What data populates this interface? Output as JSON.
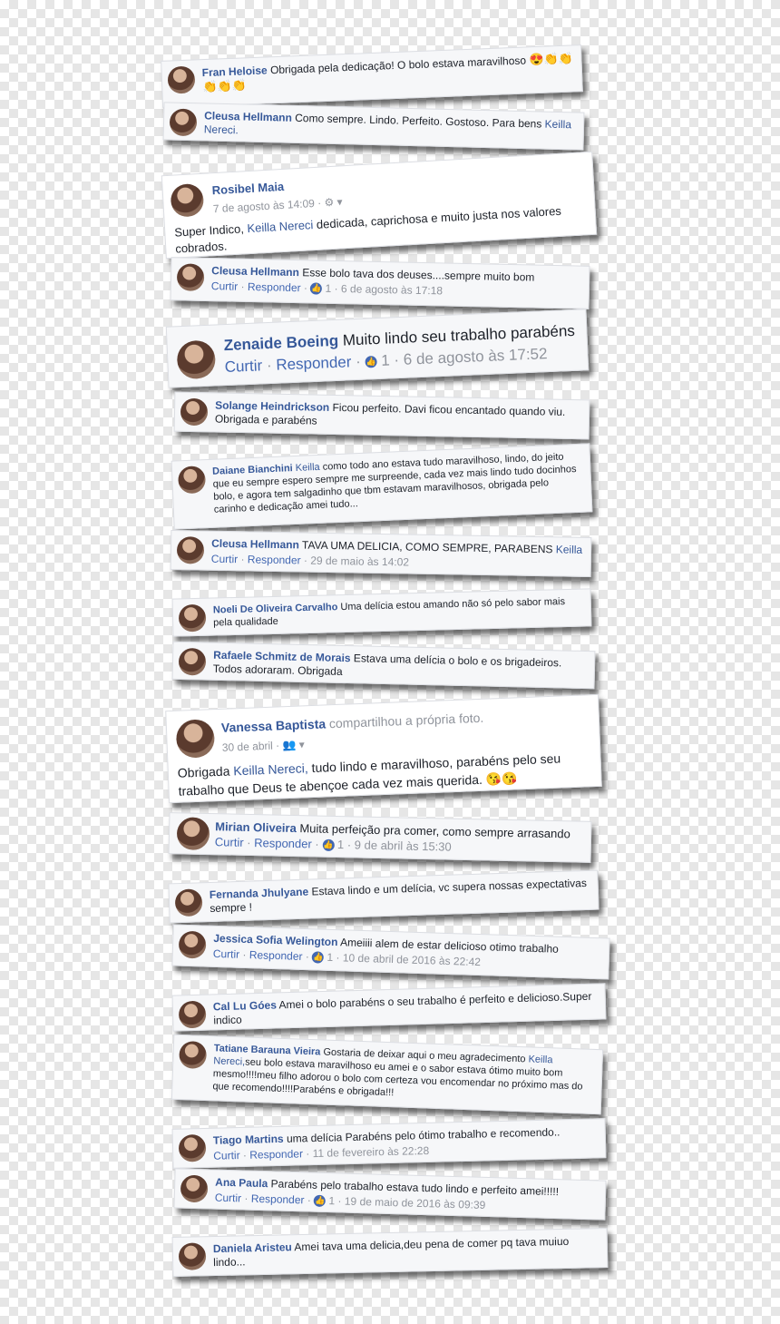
{
  "comments": [
    {
      "name": "Fran Heloise",
      "text": "Obrigada pela dedicação! O bolo estava maravilhoso",
      "emoji": "😍👏👏👏👏👏"
    },
    {
      "name": "Cleusa Hellmann",
      "text": "Como sempre. Lindo. Perfeito. Gostoso. Para bens",
      "tag": "Keilla Nereci."
    },
    {
      "name": "Rosibel Maia",
      "date": "7 de agosto às 14:09 · ⚙ ▾",
      "text_pre": "Super Indico,",
      "tag": "Keilla Nereci",
      "text_post": "dedicada, caprichosa e muito justa nos valores cobrados."
    },
    {
      "name": "Cleusa Hellmann",
      "text": "Esse bolo tava dos deuses....sempre muito bom",
      "curtir": "Curtir",
      "responder": "Responder",
      "likes": "1",
      "date": "6 de agosto às 17:18"
    },
    {
      "name": "Zenaide Boeing",
      "text": "Muito lindo seu trabalho parabéns",
      "curtir": "Curtir",
      "responder": "Responder",
      "likes": "1",
      "date": "6 de agosto às 17:52"
    },
    {
      "name": "Solange Heindrickson",
      "text": "Ficou perfeito. Davi ficou encantado quando viu. Obrigada e parabéns"
    },
    {
      "name": "Daiane Bianchini",
      "tag": "Keilla",
      "text": "como todo ano estava tudo maravilhoso, lindo, do jeito que eu sempre espero sempre me surpreende, cada vez mais lindo tudo docinhos bolo, e agora tem salgadinho que tbm estavam maravilhosos, obrigada pelo carinho e dedicação amei tudo..."
    },
    {
      "name": "Cleusa Hellmann",
      "text": "TAVA UMA DELICIA, COMO SEMPRE, PARABENS",
      "tag": "Keilla",
      "curtir": "Curtir",
      "responder": "Responder",
      "date": "29 de maio às 14:02"
    },
    {
      "name": "Noeli De Oliveira Carvalho",
      "text": "Uma delícia estou amando não só pelo sabor mais pela qualidade"
    },
    {
      "name": "Rafaele Schmitz de Morais",
      "text": "Estava uma delícia o bolo e os brigadeiros. Todos adoraram. Obrigada"
    },
    {
      "name": "Vanessa Baptista",
      "shared": "compartilhou a própria foto.",
      "date": "30 de abril · 👥 ▾",
      "text_pre": "Obrigada",
      "tag": "Keilla Nereci,",
      "text_post": "tudo lindo e maravilhoso, parabéns pelo seu trabalho que Deus te abençoe cada vez mais querida.",
      "emoji": "😘😘"
    },
    {
      "name": "Mirian Oliveira",
      "text": "Muita perfeição pra comer, como sempre arrasando",
      "curtir": "Curtir",
      "responder": "Responder",
      "likes": "1",
      "date": "9 de abril às 15:30"
    },
    {
      "name": "Fernanda Jhulyane",
      "text": "Estava lindo e um delícia, vc supera nossas expectativas sempre !"
    },
    {
      "name": "Jessica Sofia Welington",
      "text": "Ameiiii alem de estar delicioso otimo trabalho",
      "curtir": "Curtir",
      "responder": "Responder",
      "likes": "1",
      "date": "10 de abril de 2016 às 22:42"
    },
    {
      "name": "Cal Lu Góes",
      "text": "Amei o bolo parabéns o seu trabalho é perfeito e delicioso.Super indico"
    },
    {
      "name": "Tatiane Barauna Vieira",
      "text": "Gostaria de deixar aqui o meu agradecimento",
      "tag": "Keilla Nereci,",
      "text_post": "seu bolo estava maravilhoso eu amei e o sabor estava ótimo muito bom mesmo!!!!meu filho adorou o bolo com certeza vou encomendar no próximo mas do que recomendo!!!!Parabéns e obrigada!!!"
    },
    {
      "name": "Tiago Martins",
      "text": "uma delícia Parabéns pelo ótimo trabalho e recomendo..",
      "curtir": "Curtir",
      "responder": "Responder",
      "date": "11 de fevereiro às 22:28"
    },
    {
      "name": "Ana Paula",
      "text": "Parabéns pelo trabalho estava tudo lindo e perfeito amei!!!!!",
      "curtir": "Curtir",
      "responder": "Responder",
      "likes": "1",
      "date": "19 de maio de 2016 às 09:39"
    },
    {
      "name": "Daniela Aristeu",
      "text": "Amei tava uma delicia,deu pena de comer pq tava muiuo lindo..."
    }
  ]
}
